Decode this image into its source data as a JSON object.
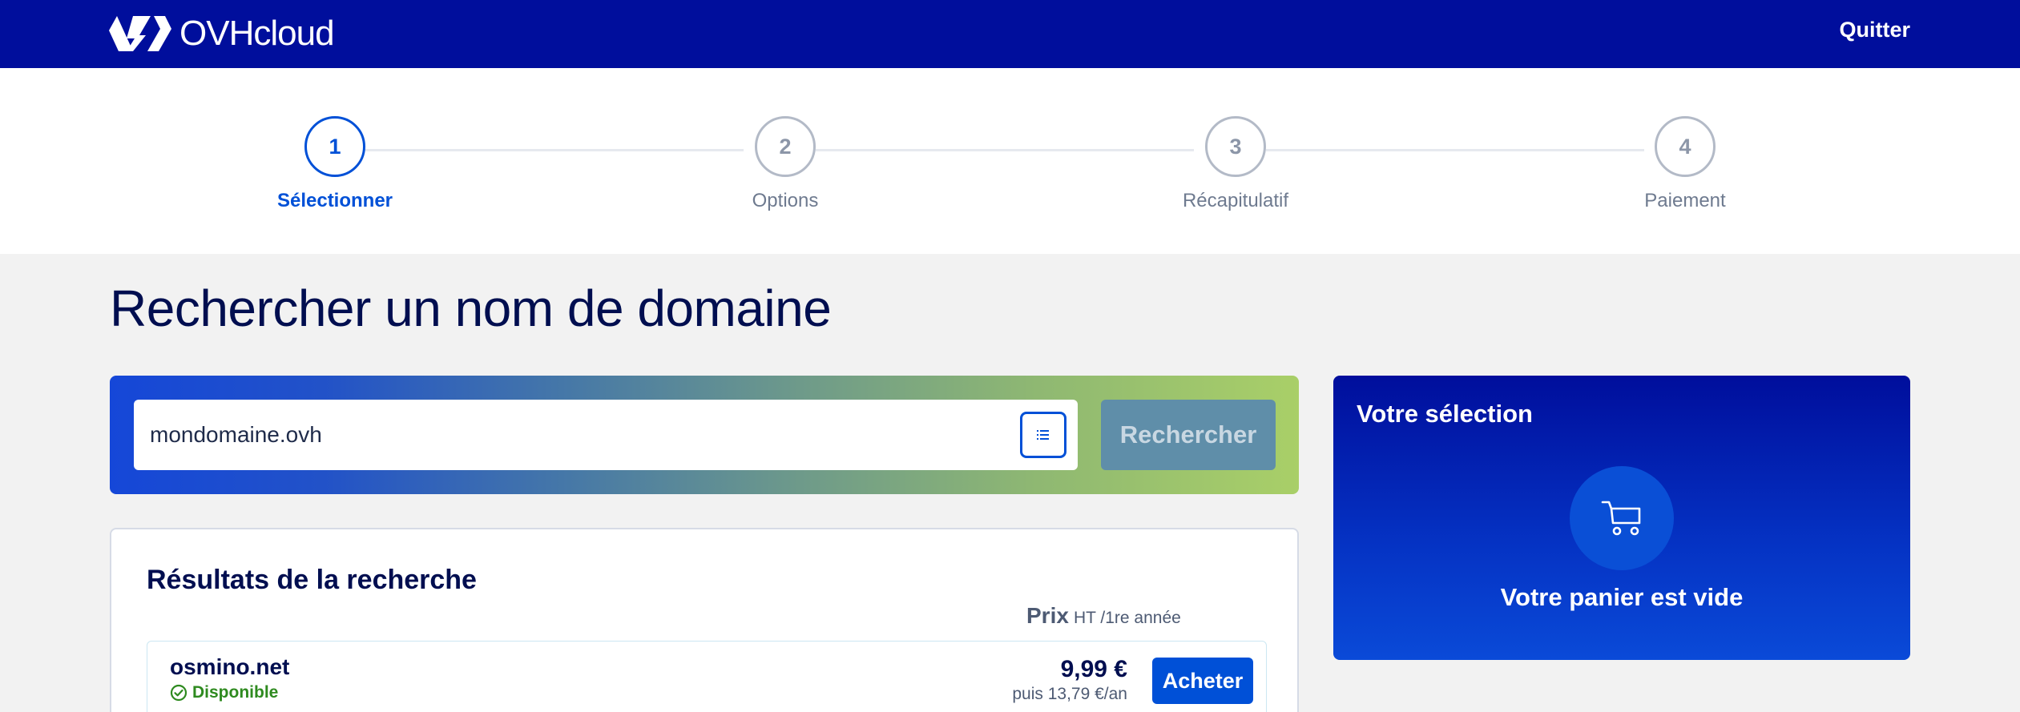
{
  "header": {
    "brand": "OVHcloud",
    "quit_label": "Quitter"
  },
  "stepper": {
    "steps": [
      {
        "number": "1",
        "label": "Sélectionner",
        "active": true
      },
      {
        "number": "2",
        "label": "Options",
        "active": false
      },
      {
        "number": "3",
        "label": "Récapitulatif",
        "active": false
      },
      {
        "number": "4",
        "label": "Paiement",
        "active": false
      }
    ]
  },
  "page": {
    "title": "Rechercher un nom de domaine"
  },
  "search": {
    "value": "mondomaine.ovh",
    "button_label": "Rechercher",
    "list_icon": "list-icon"
  },
  "results": {
    "title": "Résultats de la recherche",
    "price_label": "Prix",
    "price_suffix": "HT /1re année",
    "items": [
      {
        "domain": "osmino.net",
        "status": "Disponible",
        "price": "9,99 €",
        "renewal": "puis 13,79 €/an",
        "buy_label": "Acheter"
      }
    ]
  },
  "selection": {
    "title": "Votre sélection",
    "empty_text": "Votre panier est vide",
    "icon": "cart-icon"
  },
  "colors": {
    "header_bg": "#000e9c",
    "primary": "#0050d7",
    "success": "#2e8a1f"
  }
}
